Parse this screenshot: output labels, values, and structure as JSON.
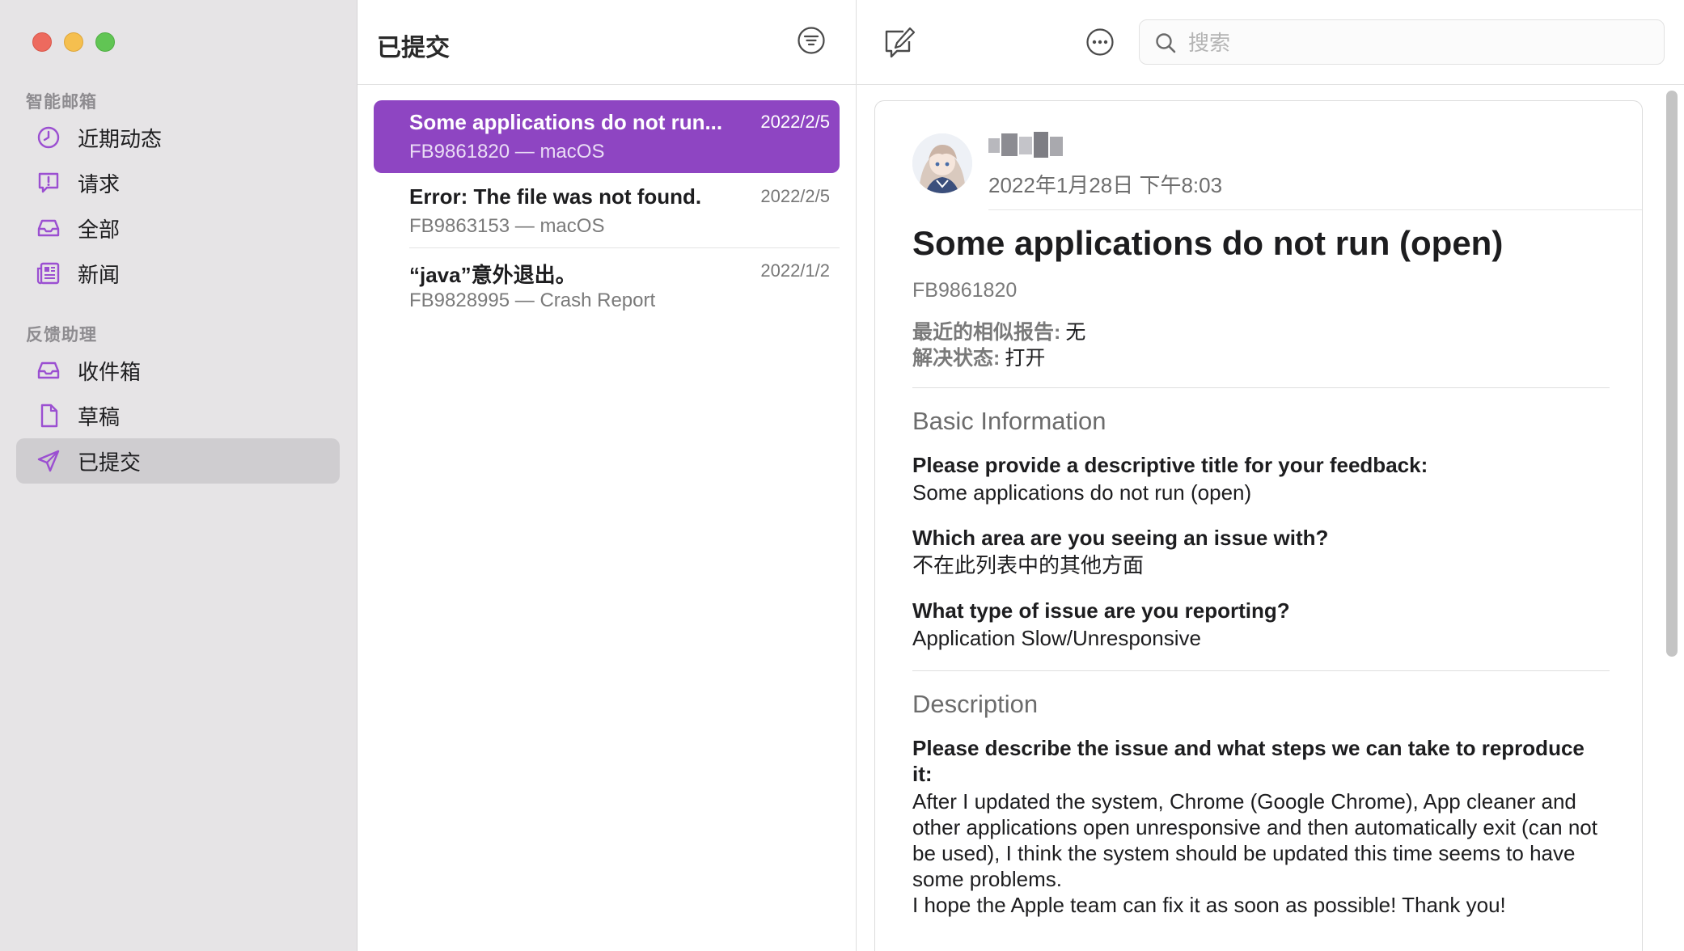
{
  "sidebar": {
    "smart_mailboxes_title": "智能邮箱",
    "smart_items": [
      {
        "label": "近期动态",
        "icon": "clock-icon"
      },
      {
        "label": "请求",
        "icon": "exclamation-bubble-icon"
      },
      {
        "label": "全部",
        "icon": "tray-icon"
      },
      {
        "label": "新闻",
        "icon": "newspaper-icon"
      }
    ],
    "assistant_title": "反馈助理",
    "assistant_items": [
      {
        "label": "收件箱",
        "icon": "tray-icon"
      },
      {
        "label": "草稿",
        "icon": "document-icon"
      },
      {
        "label": "已提交",
        "icon": "paperplane-icon",
        "selected": true
      }
    ]
  },
  "list": {
    "title": "已提交",
    "messages": [
      {
        "subject": "Some applications do not run...",
        "date": "2022/2/5",
        "sub": "FB9861820 — macOS",
        "selected": true
      },
      {
        "subject": "Error: The file was not found.",
        "date": "2022/2/5",
        "sub": "FB9863153 — macOS"
      },
      {
        "subject": "“java”意外退出。",
        "date": "2022/1/2",
        "sub": "FB9828995 — Crash Report"
      }
    ]
  },
  "toolbar": {
    "search_placeholder": "搜索"
  },
  "detail": {
    "sent_date": "2022年1月28日 下午8:03",
    "title": "Some applications do not run (open)",
    "feedback_id": "FB9861820",
    "similar_reports_label": "最近的相似报告:",
    "similar_reports_value": "无",
    "resolution_label": "解决状态:",
    "resolution_value": "打开",
    "basic_info_heading": "Basic Information",
    "q1": "Please provide a descriptive title for your feedback:",
    "a1": "Some applications do not run (open)",
    "q2": "Which area are you seeing an issue with?",
    "a2": "不在此列表中的其他方面",
    "q3": "What type of issue are you reporting?",
    "a3": "Application Slow/Unresponsive",
    "description_heading": "Description",
    "q4": "Please describe the issue and what steps we can take to reproduce it:",
    "a4": "After I updated the system, Chrome (Google Chrome), App cleaner and other applications open unresponsive and then automatically exit (can not be used), I think the system should be updated this time seems to have some problems.",
    "a5": "I hope the Apple team can fix it as soon as possible! Thank you!"
  },
  "colors": {
    "accent": "#8e45c2",
    "sidebar_bg": "#e6e4e6",
    "sidebar_selected": "#cfcdd0",
    "icon_purple": "#9b4fd1"
  }
}
